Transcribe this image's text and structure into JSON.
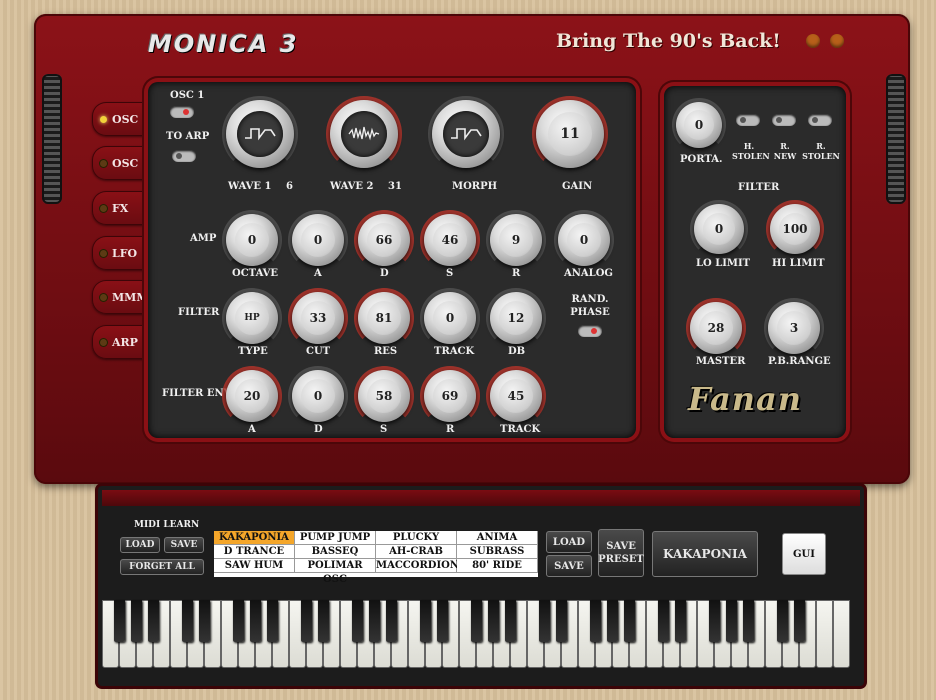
{
  "header": {
    "logo": "MONICA 3",
    "tagline": "Bring The 90's Back!"
  },
  "tabs": [
    {
      "label": "OSC 1",
      "active": true
    },
    {
      "label": "OSC 2",
      "active": false
    },
    {
      "label": "FX",
      "active": false
    },
    {
      "label": "LFO",
      "active": false
    },
    {
      "label": "MMM",
      "active": false
    },
    {
      "label": "ARP",
      "active": false
    }
  ],
  "osc": {
    "osc1_label": "OSC 1",
    "to_arp_label": "TO ARP",
    "wave1": {
      "label": "WAVE 1",
      "value": "6"
    },
    "wave2": {
      "label": "WAVE 2",
      "value": "31"
    },
    "morph": {
      "label": "MORPH"
    },
    "gain": {
      "label": "GAIN",
      "value": "11"
    }
  },
  "amp": {
    "row_label": "AMP",
    "knobs": [
      {
        "label": "OCTAVE",
        "value": "0"
      },
      {
        "label": "A",
        "value": "0"
      },
      {
        "label": "D",
        "value": "66"
      },
      {
        "label": "S",
        "value": "46"
      },
      {
        "label": "R",
        "value": "9"
      },
      {
        "label": "ANALOG",
        "value": "0"
      }
    ]
  },
  "filter": {
    "row_label": "FILTER",
    "knobs": [
      {
        "label": "TYPE",
        "value": "HP"
      },
      {
        "label": "CUT",
        "value": "33"
      },
      {
        "label": "RES",
        "value": "81"
      },
      {
        "label": "TRACK",
        "value": "0"
      },
      {
        "label": "DB",
        "value": "12"
      }
    ],
    "rand_phase_label": "RAND. PHASE"
  },
  "filter_env": {
    "row_label": "FILTER ENV",
    "knobs": [
      {
        "label": "A",
        "value": "20"
      },
      {
        "label": "D",
        "value": "0"
      },
      {
        "label": "S",
        "value": "58"
      },
      {
        "label": "R",
        "value": "69"
      },
      {
        "label": "TRACK",
        "value": "45"
      }
    ]
  },
  "right_panel": {
    "porta": {
      "label": "PORTA.",
      "value": "0"
    },
    "switches": [
      {
        "label": "H. STOLEN"
      },
      {
        "label": "R. NEW"
      },
      {
        "label": "R. STOLEN"
      }
    ],
    "filter_title": "FILTER",
    "lo_limit": {
      "label": "LO LIMIT",
      "value": "0"
    },
    "hi_limit": {
      "label": "HI LIMIT",
      "value": "100"
    },
    "master": {
      "label": "MASTER",
      "value": "28"
    },
    "pb_range": {
      "label": "P.B.RANGE",
      "value": "3"
    },
    "brand": "Fanan"
  },
  "bottom": {
    "midi_learn_label": "MIDI LEARN",
    "load_label": "LOAD",
    "save_label": "SAVE",
    "forget_all_label": "FORGET ALL",
    "presets": [
      "KAKAPONIA",
      "PUMP JUMP",
      "PLUCKY",
      "ANIMA",
      "D TRANCE",
      "BASSEQ",
      "AH-CRAB",
      "SUBRASS",
      "SAW HUM",
      "POLIMAR OSC",
      "MACCORDION",
      "80' RIDE"
    ],
    "selected_preset_index": 0,
    "preset_load_label": "LOAD",
    "preset_save_label": "SAVE",
    "save_preset_label": "SAVE PRESET",
    "current_preset": "KAKAPONIA",
    "gui_label": "GUI"
  },
  "colors": {
    "body_red": "#8c1218",
    "panel": "#2b2b2b",
    "selected_preset": "#f4a62a"
  }
}
